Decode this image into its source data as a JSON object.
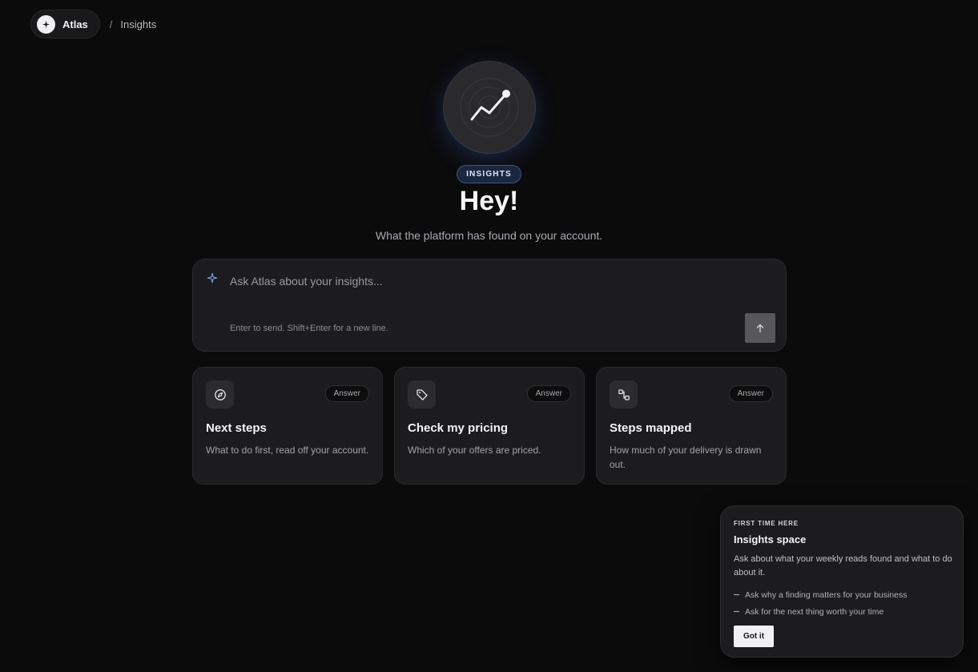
{
  "breadcrumb": {
    "brand": "Atlas",
    "separator": "/",
    "current": "Insights"
  },
  "hero": {
    "icon": "trend-chart-icon",
    "badge": "INSIGHTS",
    "title": "Hey!",
    "subtitle": "What the platform has found on your account."
  },
  "ask": {
    "icon": "sparkle-icon",
    "placeholder": "Ask Atlas about your insights...",
    "value": "",
    "hint": "Enter to send. Shift+Enter for a new line.",
    "send_icon": "arrow-up-icon"
  },
  "cards": [
    {
      "icon": "compass-icon",
      "tag": "Answer",
      "title": "Next steps",
      "description": "What to do first, read off your account."
    },
    {
      "icon": "tag-icon",
      "tag": "Answer",
      "title": "Check my pricing",
      "description": "Which of your offers are priced."
    },
    {
      "icon": "route-icon",
      "tag": "Answer",
      "title": "Steps mapped",
      "description": "How much of your delivery is drawn out."
    }
  ],
  "popover": {
    "eyebrow": "FIRST TIME HERE",
    "title": "Insights space",
    "body": "Ask about what your weekly reads found and what to do about it.",
    "items": [
      "Ask why a finding matters for your business",
      "Ask for the next thing worth your time"
    ],
    "button": "Got it"
  },
  "colors": {
    "background": "#0b0b0c",
    "surface": "#1c1c1e",
    "accent": "#3c5383",
    "sparkle": "#7fa2f0"
  }
}
